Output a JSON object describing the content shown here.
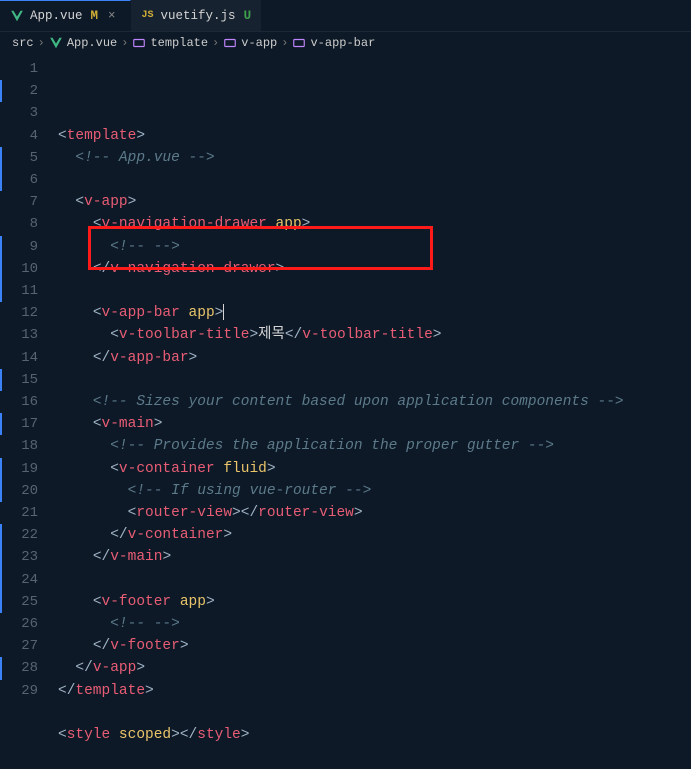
{
  "tabs": [
    {
      "icon": "vue",
      "label": "App.vue",
      "modifier": "M",
      "modClass": "mod-m",
      "active": true,
      "closable": true
    },
    {
      "icon": "js",
      "label": "vuetify.js",
      "modifier": "U",
      "modClass": "mod-u",
      "active": false,
      "closable": false
    }
  ],
  "breadcrumb": [
    {
      "label": "src",
      "icon": ""
    },
    {
      "label": "App.vue",
      "icon": "vue"
    },
    {
      "label": "template",
      "icon": "block"
    },
    {
      "label": "v-app",
      "icon": "block"
    },
    {
      "label": "v-app-bar",
      "icon": "block"
    }
  ],
  "highlight_line_index": 9,
  "code": [
    [
      {
        "t": "punc",
        "v": "<"
      },
      {
        "t": "tag",
        "v": "template"
      },
      {
        "t": "punc",
        "v": ">"
      }
    ],
    [
      {
        "t": "indent",
        "v": "  "
      },
      {
        "t": "comment",
        "v": "<!-- App.vue -->"
      }
    ],
    [
      {
        "t": "indent",
        "v": ""
      }
    ],
    [
      {
        "t": "indent",
        "v": "  "
      },
      {
        "t": "punc",
        "v": "<"
      },
      {
        "t": "tag",
        "v": "v-app"
      },
      {
        "t": "punc",
        "v": ">"
      }
    ],
    [
      {
        "t": "indent",
        "v": "    "
      },
      {
        "t": "punc",
        "v": "<"
      },
      {
        "t": "tag",
        "v": "v-navigation-drawer"
      },
      {
        "t": "text",
        "v": " "
      },
      {
        "t": "attr",
        "v": "app"
      },
      {
        "t": "punc",
        "v": ">"
      }
    ],
    [
      {
        "t": "indent",
        "v": "      "
      },
      {
        "t": "comment",
        "v": "<!-- -->"
      }
    ],
    [
      {
        "t": "indent",
        "v": "    "
      },
      {
        "t": "punc",
        "v": "</"
      },
      {
        "t": "tag",
        "v": "v-navigation-drawer"
      },
      {
        "t": "punc",
        "v": ">"
      }
    ],
    [
      {
        "t": "indent",
        "v": ""
      }
    ],
    [
      {
        "t": "indent",
        "v": "    "
      },
      {
        "t": "punc",
        "v": "<"
      },
      {
        "t": "tag",
        "v": "v-app-bar"
      },
      {
        "t": "text",
        "v": " "
      },
      {
        "t": "attr",
        "v": "app"
      },
      {
        "t": "punc",
        "v": ">"
      },
      {
        "t": "cursor",
        "v": ""
      }
    ],
    [
      {
        "t": "indent",
        "v": "      "
      },
      {
        "t": "punc",
        "v": "<"
      },
      {
        "t": "tag",
        "v": "v-toolbar-title"
      },
      {
        "t": "punc",
        "v": ">"
      },
      {
        "t": "text",
        "v": "제목"
      },
      {
        "t": "punc",
        "v": "</"
      },
      {
        "t": "tag",
        "v": "v-toolbar-title"
      },
      {
        "t": "punc",
        "v": ">"
      }
    ],
    [
      {
        "t": "indent",
        "v": "    "
      },
      {
        "t": "punc",
        "v": "</"
      },
      {
        "t": "tag",
        "v": "v-app-bar"
      },
      {
        "t": "punc",
        "v": ">"
      }
    ],
    [
      {
        "t": "indent",
        "v": ""
      }
    ],
    [
      {
        "t": "indent",
        "v": "    "
      },
      {
        "t": "comment",
        "v": "<!-- Sizes your content based upon application components -->"
      }
    ],
    [
      {
        "t": "indent",
        "v": "    "
      },
      {
        "t": "punc",
        "v": "<"
      },
      {
        "t": "tag",
        "v": "v-main"
      },
      {
        "t": "punc",
        "v": ">"
      }
    ],
    [
      {
        "t": "indent",
        "v": "      "
      },
      {
        "t": "comment",
        "v": "<!-- Provides the application the proper gutter -->"
      }
    ],
    [
      {
        "t": "indent",
        "v": "      "
      },
      {
        "t": "punc",
        "v": "<"
      },
      {
        "t": "tag",
        "v": "v-container"
      },
      {
        "t": "text",
        "v": " "
      },
      {
        "t": "attr",
        "v": "fluid"
      },
      {
        "t": "punc",
        "v": ">"
      }
    ],
    [
      {
        "t": "indent",
        "v": "        "
      },
      {
        "t": "comment",
        "v": "<!-- If using vue-router -->"
      }
    ],
    [
      {
        "t": "indent",
        "v": "        "
      },
      {
        "t": "punc",
        "v": "<"
      },
      {
        "t": "tag",
        "v": "router-view"
      },
      {
        "t": "punc",
        "v": ">"
      },
      {
        "t": "punc",
        "v": "</"
      },
      {
        "t": "tag",
        "v": "router-view"
      },
      {
        "t": "punc",
        "v": ">"
      }
    ],
    [
      {
        "t": "indent",
        "v": "      "
      },
      {
        "t": "punc",
        "v": "</"
      },
      {
        "t": "tag",
        "v": "v-container"
      },
      {
        "t": "punc",
        "v": ">"
      }
    ],
    [
      {
        "t": "indent",
        "v": "    "
      },
      {
        "t": "punc",
        "v": "</"
      },
      {
        "t": "tag",
        "v": "v-main"
      },
      {
        "t": "punc",
        "v": ">"
      }
    ],
    [
      {
        "t": "indent",
        "v": ""
      }
    ],
    [
      {
        "t": "indent",
        "v": "    "
      },
      {
        "t": "punc",
        "v": "<"
      },
      {
        "t": "tag",
        "v": "v-footer"
      },
      {
        "t": "text",
        "v": " "
      },
      {
        "t": "attr",
        "v": "app"
      },
      {
        "t": "punc",
        "v": ">"
      }
    ],
    [
      {
        "t": "indent",
        "v": "      "
      },
      {
        "t": "comment",
        "v": "<!-- -->"
      }
    ],
    [
      {
        "t": "indent",
        "v": "    "
      },
      {
        "t": "punc",
        "v": "</"
      },
      {
        "t": "tag",
        "v": "v-footer"
      },
      {
        "t": "punc",
        "v": ">"
      }
    ],
    [
      {
        "t": "indent",
        "v": "  "
      },
      {
        "t": "punc",
        "v": "</"
      },
      {
        "t": "tag",
        "v": "v-app"
      },
      {
        "t": "punc",
        "v": ">"
      }
    ],
    [
      {
        "t": "punc",
        "v": "</"
      },
      {
        "t": "tag",
        "v": "template"
      },
      {
        "t": "punc",
        "v": ">"
      }
    ],
    [
      {
        "t": "indent",
        "v": ""
      }
    ],
    [
      {
        "t": "punc",
        "v": "<"
      },
      {
        "t": "tag",
        "v": "style"
      },
      {
        "t": "text",
        "v": " "
      },
      {
        "t": "attr",
        "v": "scoped"
      },
      {
        "t": "punc",
        "v": ">"
      },
      {
        "t": "punc",
        "v": "</"
      },
      {
        "t": "tag",
        "v": "style"
      },
      {
        "t": "punc",
        "v": ">"
      }
    ],
    [
      {
        "t": "indent",
        "v": ""
      }
    ]
  ],
  "modified_lines": [
    2,
    5,
    6,
    9,
    10,
    11,
    15,
    17,
    19,
    20,
    22,
    23,
    24,
    25,
    28
  ]
}
